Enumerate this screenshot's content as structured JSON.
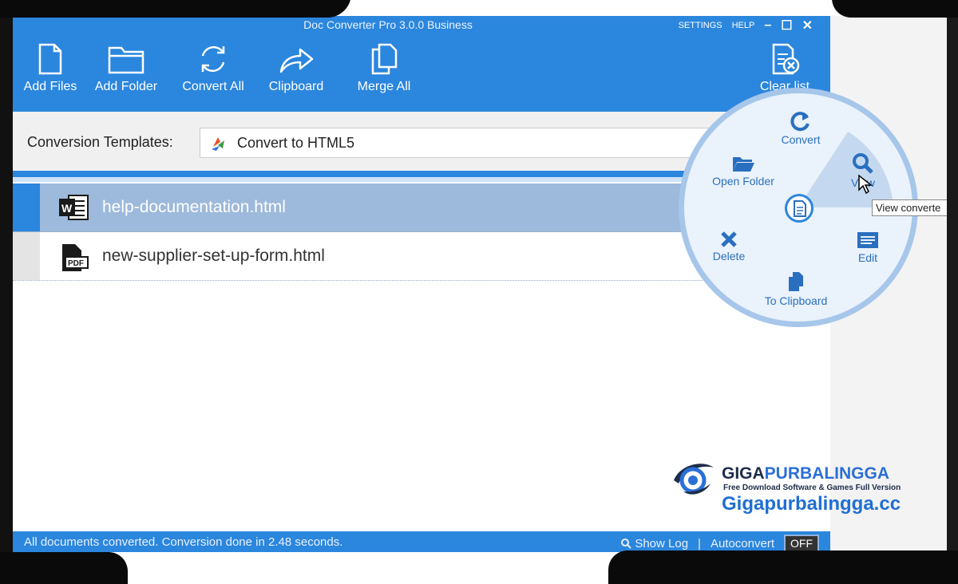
{
  "window": {
    "title": "Doc Converter Pro 3.0.0 Business",
    "links": [
      "SETTINGS",
      "HELP"
    ],
    "controls": [
      "–",
      "☐",
      "✕"
    ]
  },
  "toolbar": {
    "items": [
      {
        "label": "Add Files",
        "icon": "file-icon"
      },
      {
        "label": "Add Folder",
        "icon": "folder-icon"
      },
      {
        "label": "Convert All",
        "icon": "refresh-icon"
      },
      {
        "label": "Clipboard",
        "icon": "share-arrow-icon"
      },
      {
        "label": "Merge All",
        "icon": "merge-icon"
      },
      {
        "label": "Clear list",
        "icon": "clear-list-icon"
      }
    ]
  },
  "templates": {
    "label": "Conversion Templates:",
    "selected": "Convert to HTML5"
  },
  "files": [
    {
      "name": "help-documentation.html",
      "icon": "word-doc-icon",
      "selected": true
    },
    {
      "name": "new-supplier-set-up-form.html",
      "icon": "pdf-doc-icon",
      "selected": false
    }
  ],
  "radial_menu": {
    "items": {
      "convert": "Convert",
      "view": "View",
      "open_folder": "Open Folder",
      "edit": "Edit",
      "delete": "Delete",
      "to_clipboard": "To Clipboard"
    },
    "tooltip": "View converte"
  },
  "status": {
    "message": "All documents converted. Conversion done in 2.48 seconds.",
    "show_log": "Show Log",
    "separator": "|",
    "autoconvert": "Autoconvert",
    "toggle": "OFF"
  },
  "watermark": {
    "brand_a": "GIGA",
    "brand_b": "PURBALINGGA",
    "tagline": "Free Download Software & Games Full Version",
    "url": "Gigapurbalingga.cc"
  },
  "colors": {
    "accent": "#2b86dd",
    "selected_row": "#9db9db",
    "radial_bg": "#eaf2fb"
  }
}
